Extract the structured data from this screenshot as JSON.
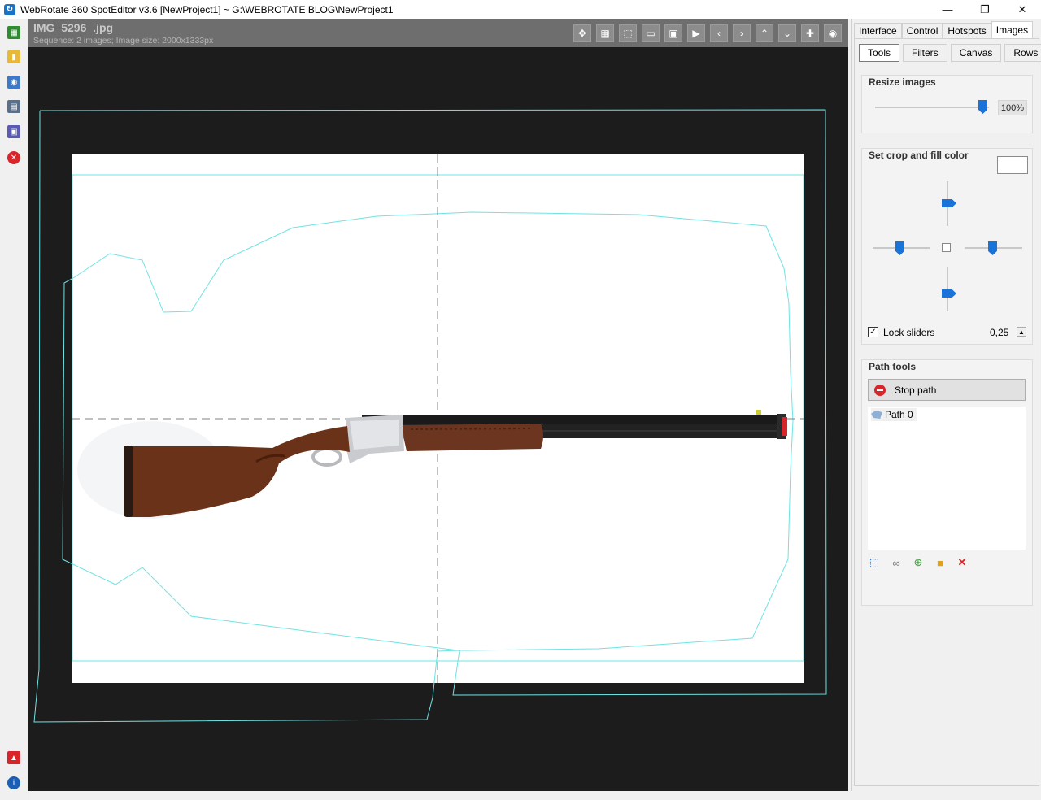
{
  "window": {
    "title": "WebRotate 360 SpotEditor v3.6 [NewProject1] ~ G:\\WEBROTATE BLOG\\NewProject1",
    "app_icon": "webrotate-logo-icon",
    "minimize": "—",
    "restore": "❐",
    "close": "✕"
  },
  "left_toolbar": [
    {
      "name": "add-images-icon",
      "color": "#2e8b2e"
    },
    {
      "name": "open-folder-icon",
      "color": "#e8b937"
    },
    {
      "name": "publish-icon",
      "color": "#3f78c7"
    },
    {
      "name": "print-icon",
      "color": "#5b6f8a"
    },
    {
      "name": "save-icon",
      "color": "#5a5ab5"
    },
    {
      "name": "close-project-icon",
      "color": "#d9252a"
    },
    {
      "name": "pdf-help-icon",
      "color": "#d9252a"
    },
    {
      "name": "info-icon",
      "color": "#1a5fb4"
    }
  ],
  "viewer": {
    "image_name": "IMG_5296_.jpg",
    "sequence_info": "Sequence: 2 images; Image size: 2000x1333px",
    "toolbar": [
      "move-icon",
      "grid-icon",
      "selection-icon",
      "crop-icon",
      "fit-icon",
      "play-icon",
      "prev-icon",
      "next-icon",
      "up-icon",
      "down-icon",
      "zoom-in-icon",
      "record-icon"
    ]
  },
  "right_panel": {
    "tabs": [
      "Interface",
      "Control",
      "Hotspots",
      "Images"
    ],
    "active_tab": "Images",
    "subtabs": [
      "Tools",
      "Filters",
      "Canvas",
      "Rows"
    ],
    "active_subtab": "Tools",
    "resize": {
      "title": "Resize images",
      "value": "100%",
      "level": 1.0
    },
    "crop": {
      "title": "Set crop and fill color",
      "fill_color": "#ffffff",
      "lock_label": "Lock sliders",
      "lock_checked": true,
      "lock_value": "0,25"
    },
    "path_tools": {
      "title": "Path tools",
      "stop_button": "Stop path",
      "paths": [
        "Path 0"
      ],
      "tool_icons": [
        "select-rect-icon",
        "link-icon",
        "add-link-icon",
        "unlock-icon",
        "delete-icon"
      ]
    }
  }
}
